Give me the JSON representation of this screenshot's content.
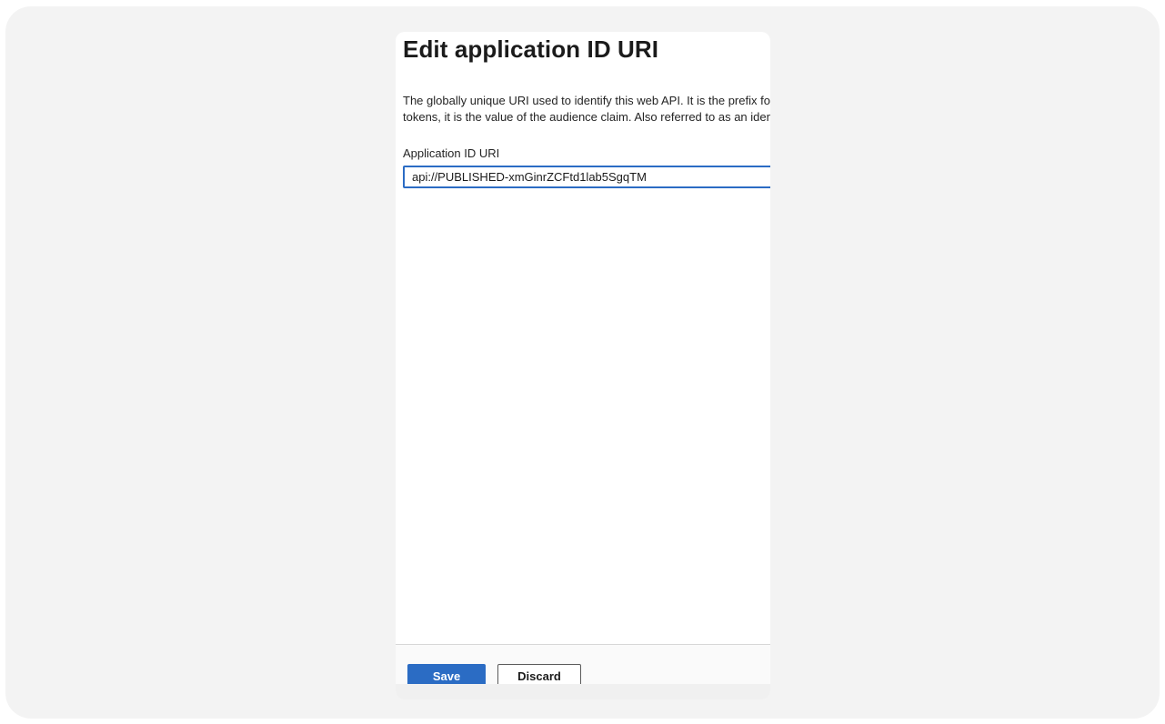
{
  "panel": {
    "title": "Edit application ID URI",
    "description_line1": "The globally unique URI used to identify this web API. It is the prefix for scopes and in access",
    "description_line2": "tokens, it is the value of the audience claim. Also referred to as an identifier URI."
  },
  "uri_field": {
    "label": "Application ID URI",
    "value": "api://PUBLISHED-xmGinrZCFtd1lab5SgqTM",
    "placeholder": ""
  },
  "footer": {
    "save_label": "Save",
    "discard_label": "Discard"
  },
  "colors": {
    "accent": "#2b6cc4",
    "outer_frame": "#f3f3f3"
  }
}
